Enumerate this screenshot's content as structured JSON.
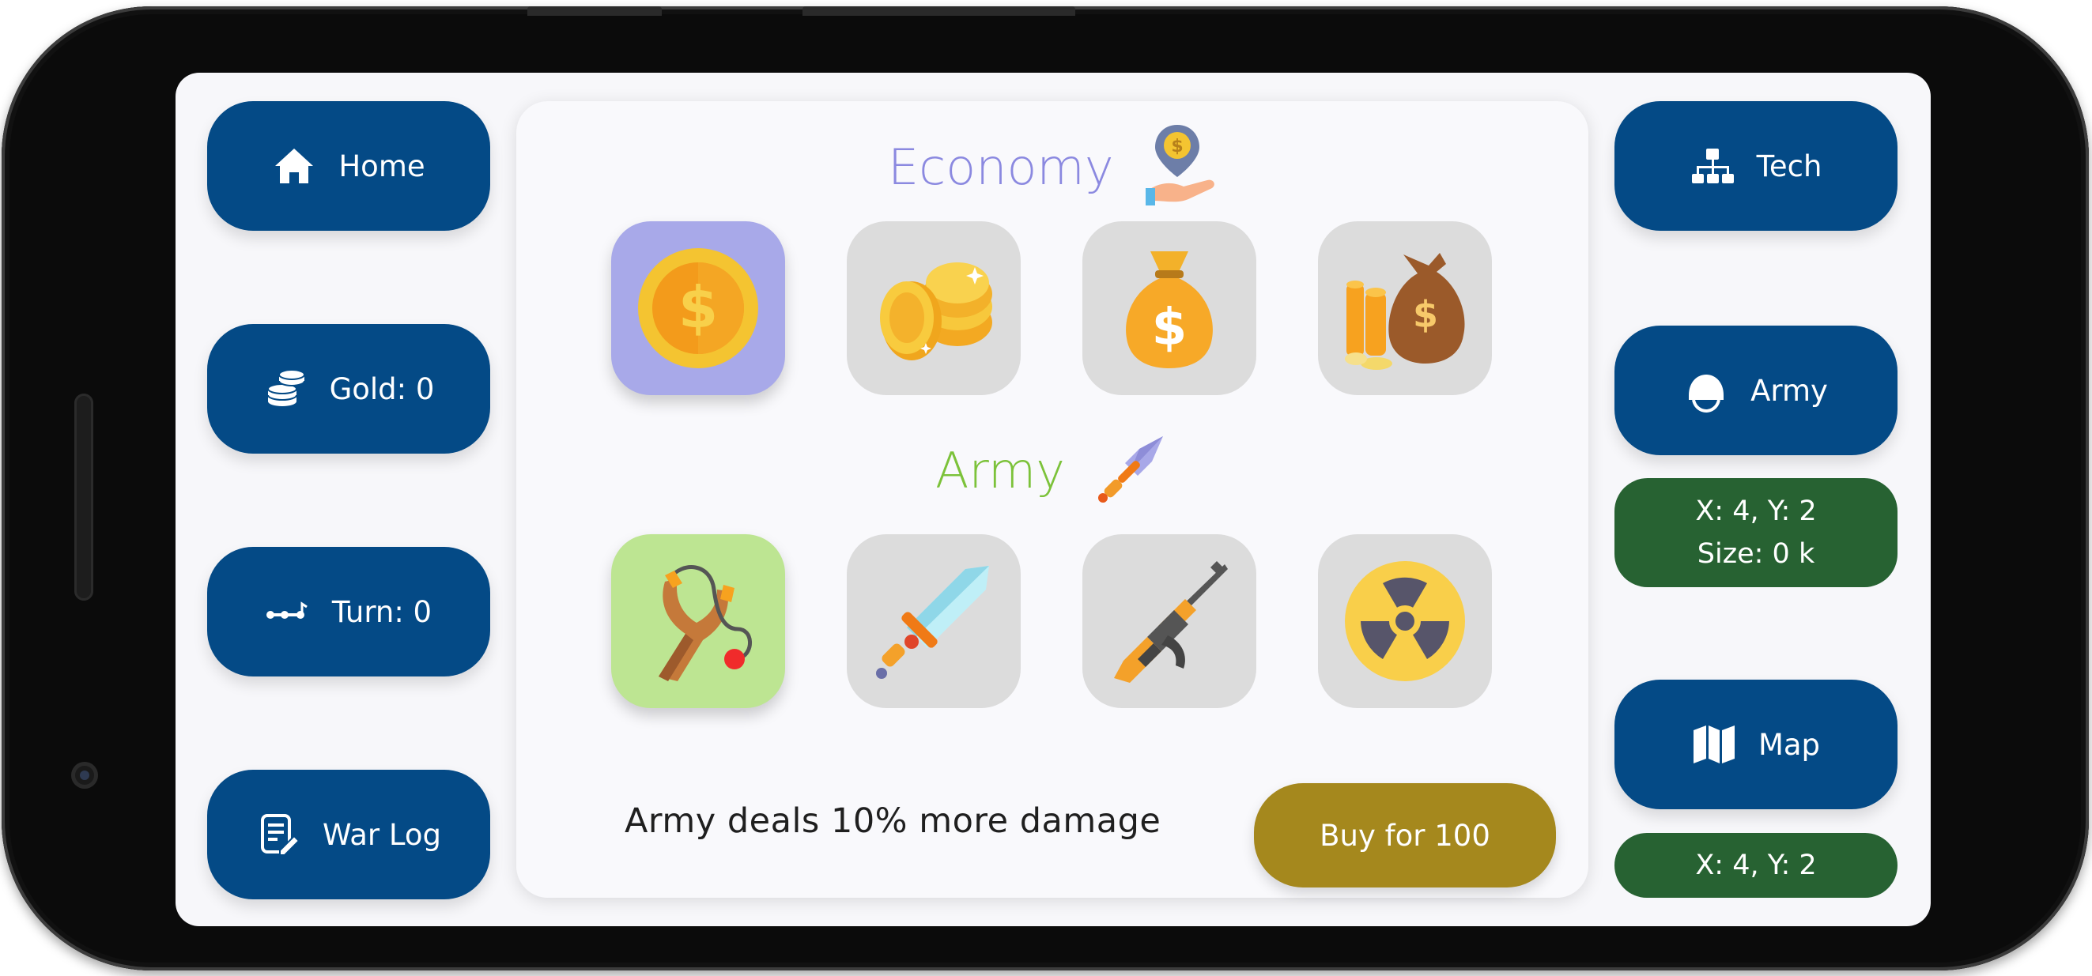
{
  "left_nav": {
    "home": "Home",
    "gold": "Gold: 0",
    "turn": "Turn: 0",
    "war_log": "War Log"
  },
  "right_nav": {
    "tech": "Tech",
    "army": "Army",
    "army_info_line1": "X: 4, Y: 2",
    "army_info_line2": "Size: 0 k",
    "map": "Map",
    "map_info": "X: 4, Y: 2"
  },
  "economy": {
    "title": "Economy",
    "title_color": "#8b89e0",
    "icon": "money-location-icon",
    "items": [
      {
        "icon": "gold-coin-icon",
        "selected": true
      },
      {
        "icon": "coin-stack-icon",
        "selected": false
      },
      {
        "icon": "money-bag-icon",
        "selected": false
      },
      {
        "icon": "treasure-bag-icon",
        "selected": false
      }
    ]
  },
  "army": {
    "title": "Army",
    "title_color": "#7cc23a",
    "icon": "dagger-icon",
    "items": [
      {
        "icon": "slingshot-icon",
        "selected": true
      },
      {
        "icon": "sword-icon",
        "selected": false
      },
      {
        "icon": "rifle-icon",
        "selected": false
      },
      {
        "icon": "radiation-icon",
        "selected": false
      }
    ]
  },
  "footer": {
    "description": "Army deals 10% more damage",
    "buy_label": "Buy for 100"
  },
  "colors": {
    "nav": "#044a86",
    "info": "#276232",
    "buy": "#a5881d",
    "selected_economy": "#a8a9e9",
    "selected_army": "#bde592",
    "tile": "#dcdcdc"
  }
}
